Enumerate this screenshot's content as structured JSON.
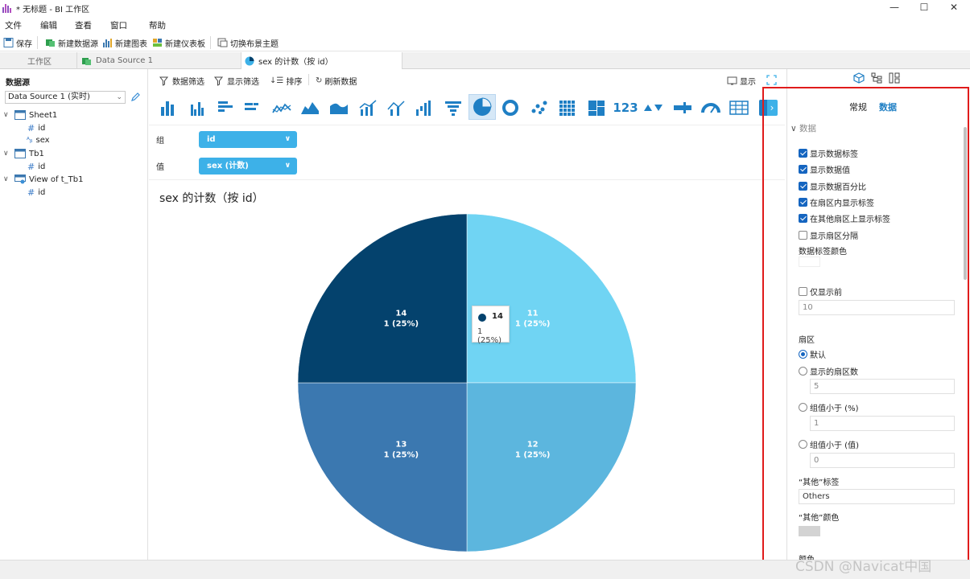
{
  "window": {
    "title": "* 无标题 - BI 工作区",
    "min": "—",
    "max": "☐",
    "close": "✕"
  },
  "menu": [
    "文件",
    "编辑",
    "查看",
    "窗口",
    "帮助"
  ],
  "toolbar": {
    "save": "保存",
    "new_datasource": "新建数据源",
    "new_chart": "新建图表",
    "new_dashboard": "新建仪表板",
    "switch_theme": "切换布景主题"
  },
  "tabs": [
    {
      "label": "工作区"
    },
    {
      "label": "Data Source 1"
    },
    {
      "label": "sex 的计数（按 id）"
    }
  ],
  "sidebar": {
    "header": "数据源",
    "source_select": "Data Source 1 (实时)",
    "tree": [
      {
        "label": "Sheet1",
        "type": "table"
      },
      {
        "label": "id",
        "type": "number"
      },
      {
        "label": "sex",
        "type": "text"
      },
      {
        "label": "Tb1",
        "type": "table"
      },
      {
        "label": "id",
        "type": "number"
      },
      {
        "label": "View of t_Tb1",
        "type": "view"
      },
      {
        "label": "id",
        "type": "number"
      }
    ]
  },
  "chart_tools": {
    "data_filter": "数据筛选",
    "display_filter": "显示筛选",
    "sort": "排序",
    "refresh": "刷新数据",
    "show": "显示"
  },
  "chart_types": [
    "bar",
    "stacked-bar",
    "horizontal-bar",
    "horizontal-bar-2",
    "line",
    "area",
    "area-2",
    "combo",
    "line-bar",
    "waterfall",
    "funnel",
    "pie",
    "doughnut",
    "scatter",
    "heatmap",
    "treemap",
    "value",
    "kpi",
    "bullet",
    "gauge",
    "table"
  ],
  "chart_types_value_label": "123",
  "fields": {
    "group_label": "组",
    "group_value": "id",
    "value_label": "值",
    "value_value": "sex (计数)"
  },
  "chart_data": {
    "type": "pie",
    "title": "sex 的计数（按 id）",
    "categories": [
      "11",
      "12",
      "13",
      "14"
    ],
    "values": [
      1,
      1,
      1,
      1
    ],
    "percent_labels": [
      "1 (25%)",
      "1 (25%)",
      "1 (25%)",
      "1 (25%)"
    ],
    "colors": [
      "#70d4f3",
      "#5cb6de",
      "#3b78b0",
      "#04426d"
    ],
    "tooltip": {
      "category": "14",
      "value": "1 (25%)"
    }
  },
  "right_panel": {
    "tab_general": "常规",
    "tab_data": "数据",
    "section": "数据",
    "options": [
      {
        "label": "显示数据标签",
        "checked": true
      },
      {
        "label": "显示数据值",
        "checked": true
      },
      {
        "label": "显示数据百分比",
        "checked": true
      },
      {
        "label": "在扇区内显示标签",
        "checked": true
      },
      {
        "label": "在其他扇区上显示标签",
        "checked": true
      },
      {
        "label": "显示扇区分隔",
        "checked": false
      }
    ],
    "label_color": "数据标签颜色",
    "show_top_only": "仅显示前",
    "top_count": "10",
    "sector_header": "扇区",
    "sector_default": "默认",
    "sector_count_label": "显示的扇区数",
    "sector_count": "5",
    "group_lt_pct_label": "组值小于 (%)",
    "group_lt_pct": "1",
    "group_lt_val_label": "组值小于 (值)",
    "group_lt_val": "0",
    "others_label_header": "“其他”标签",
    "others_label": "Others",
    "others_color_header": "“其他”颜色",
    "others_color": "#d3d3d3",
    "color_header": "颜色"
  },
  "watermark": "CSDN @Navicat中国"
}
